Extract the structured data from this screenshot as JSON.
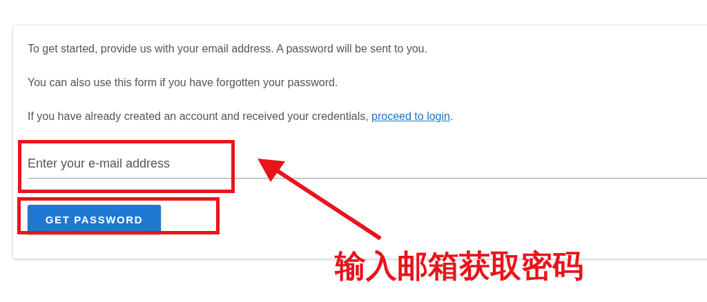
{
  "card": {
    "paragraphs": [
      {
        "text": "To get started, provide us with your email address. A password will be sent to you."
      },
      {
        "text": "You can also use this form if you have forgotten your password."
      },
      {
        "text": "If you have already created an account and received your credentials, ",
        "link": "proceed to login",
        "after": "."
      }
    ],
    "email_field": {
      "placeholder": "Enter your e-mail address"
    },
    "button": "GET PASSWORD"
  },
  "annotation": {
    "label": "输入邮箱获取密码"
  }
}
